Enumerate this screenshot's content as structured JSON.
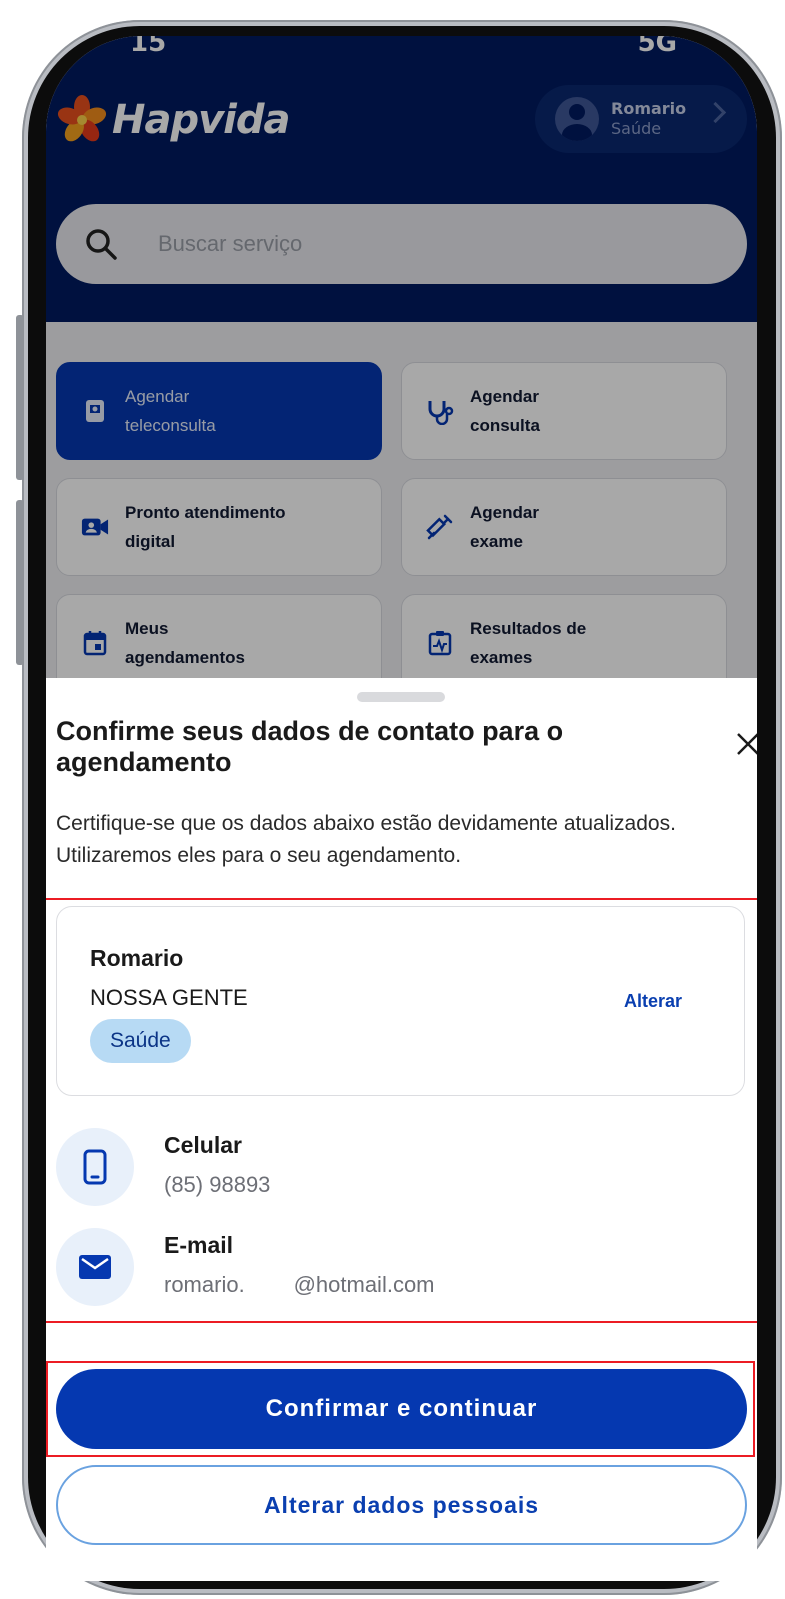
{
  "status_bar": {
    "time": "15",
    "right": "5G"
  },
  "header": {
    "brand": "Hapvida",
    "user": {
      "name": "Romario",
      "plan": "Saúde"
    },
    "search": {
      "placeholder": "Buscar serviço",
      "icon": "search-icon"
    }
  },
  "services": [
    {
      "label": "Agendar\nteleconsulta",
      "icon": "teleconsult-icon"
    },
    {
      "label": "Agendar\nconsulta",
      "icon": "stethoscope-icon"
    },
    {
      "label": "Pronto atendimento\ndigital",
      "icon": "video-call-icon"
    },
    {
      "label": "Agendar\nexame",
      "icon": "syringe-icon"
    },
    {
      "label": "Meus\nagendamentos",
      "icon": "calendar-icon"
    },
    {
      "label": "Resultados de\nexames",
      "icon": "clipboard-pulse-icon"
    }
  ],
  "sheet": {
    "title": "Confirme seus dados de contato para o agendamento",
    "description": "Certifique-se que os dados abaixo estão devidamente atualizados. Utilizaremos eles para o seu agendamento.",
    "card": {
      "name": "Romario",
      "company": "NOSSA GENTE",
      "badge": "Saúde",
      "action": "Alterar"
    },
    "phone": {
      "label": "Celular",
      "value": "(85) 98893"
    },
    "email": {
      "label": "E-mail",
      "value": "romario.        @hotmail.com"
    },
    "confirm_button": "Confirmar e continuar",
    "edit_button": "Alterar dados pessoais"
  },
  "colors": {
    "header_bg": "#011b60",
    "primary": "#0538b0",
    "highlight": "#ec1c24",
    "badge_bg": "#b7daf4"
  }
}
